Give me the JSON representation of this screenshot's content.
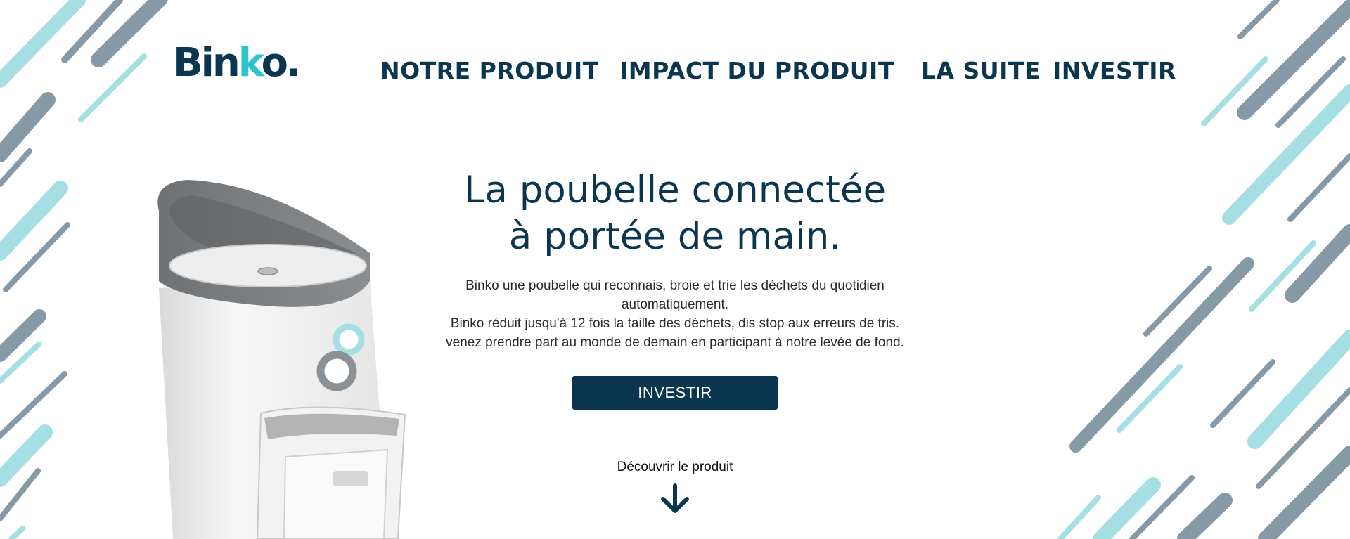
{
  "brand": {
    "logo_main": "Bin",
    "logo_accent": "k",
    "logo_tail": "o."
  },
  "nav": {
    "items": [
      {
        "label": "NOTRE PRODUIT"
      },
      {
        "label": "IMPACT DU PRODUIT"
      },
      {
        "label": "LA SUITE"
      },
      {
        "label": "INVESTIR"
      }
    ]
  },
  "hero": {
    "title_line1": "La poubelle connectée",
    "title_line2": "à portée de main.",
    "desc_lines": [
      "Binko une poubelle qui reconnais, broie et trie les déchets du quotidien",
      "automatiquement.",
      "Binko réduit jusqu'à 12 fois la taille des déchets, dis stop aux erreurs de tris.",
      "venez prendre part au monde de demain en participant à notre levée de fond."
    ],
    "cta_label": "INVESTIR",
    "discover_label": "Découvrir le produit"
  },
  "colors": {
    "navy": "#0b3650",
    "accent": "#2fc1cd",
    "stripe_light": "#a6dfe3",
    "stripe_gray": "#8699a6"
  },
  "icons": {
    "scroll": "arrow-down-icon",
    "product": "smart-bin-product-image"
  }
}
